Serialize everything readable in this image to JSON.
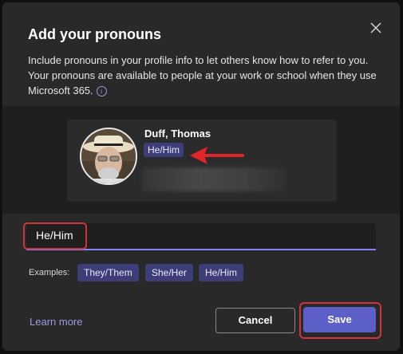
{
  "dialog": {
    "title": "Add your pronouns",
    "description": "Include pronouns in your profile info to let others know how to refer to you. Your pronouns are available to people at your work or school when they use Microsoft 365."
  },
  "preview": {
    "name": "Duff, Thomas",
    "pronoun": "He/Him"
  },
  "input": {
    "value": "He/Him",
    "placeholder": ""
  },
  "examples": {
    "label": "Examples:",
    "chips": [
      "They/Them",
      "She/Her",
      "He/Him"
    ]
  },
  "footer": {
    "learn_more": "Learn more",
    "cancel": "Cancel",
    "save": "Save"
  },
  "colors": {
    "accent": "#5b5fc7",
    "chip": "#3d3e78",
    "highlight": "#d13438",
    "link": "#9a9ae6"
  },
  "icons": {
    "close": "close-icon",
    "info": "info-icon"
  }
}
